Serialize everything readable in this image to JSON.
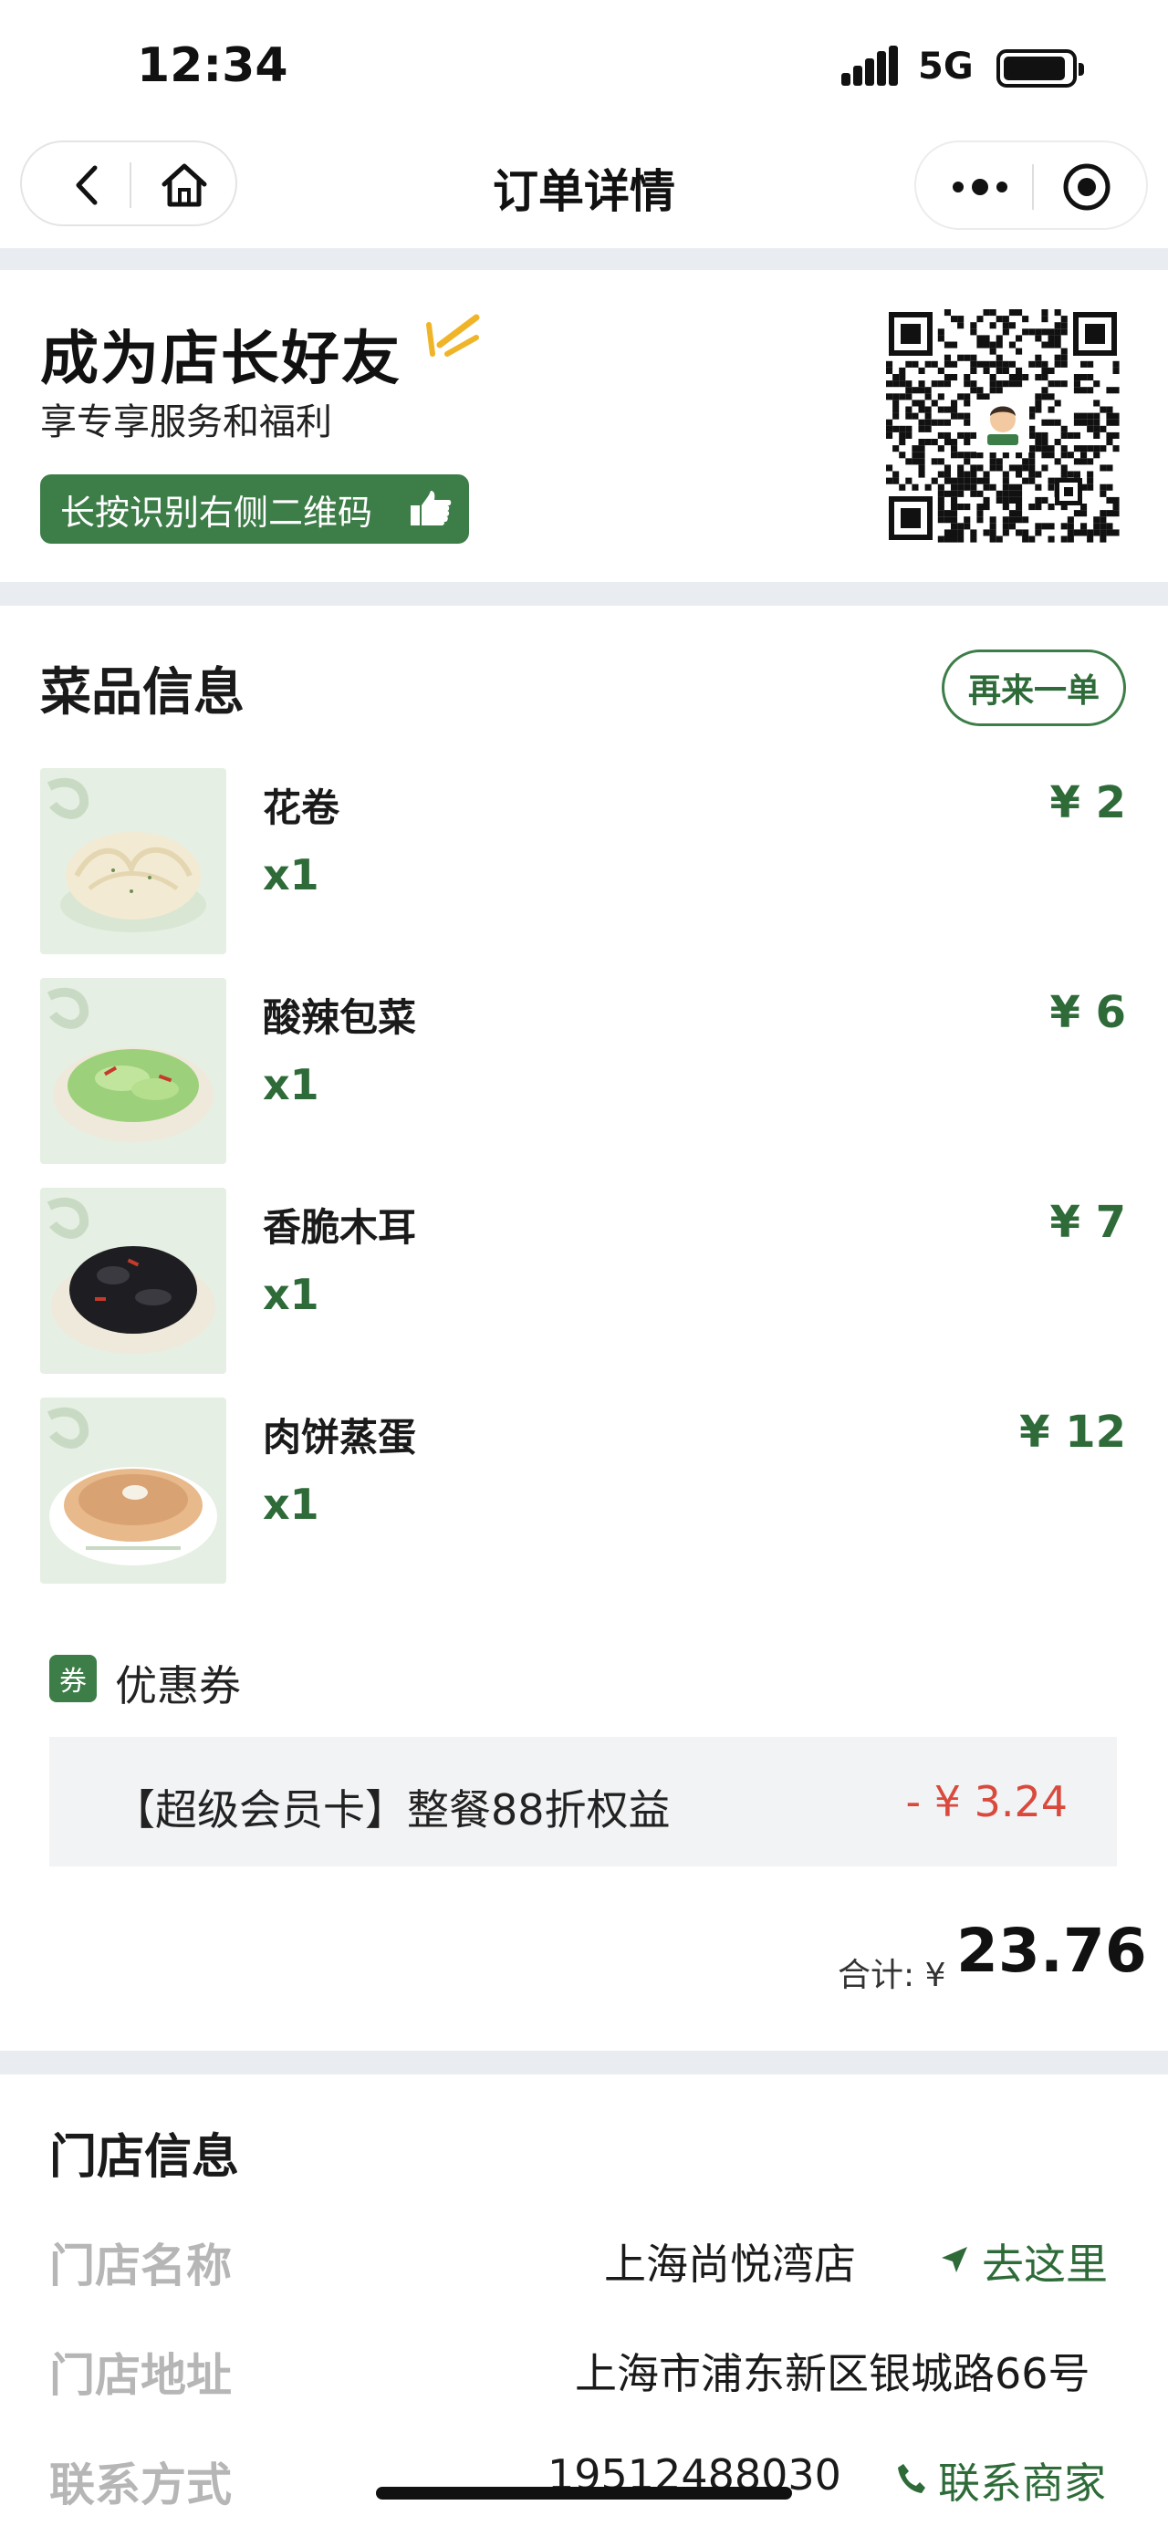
{
  "status_bar": {
    "time": "12:34",
    "network": "5G"
  },
  "nav": {
    "title": "订单详情"
  },
  "promo": {
    "title": "成为店长好友",
    "subtitle": "享专享服务和福利",
    "button_label": "长按识别右侧二维码"
  },
  "dishes": {
    "section_title": "菜品信息",
    "reorder_label": "再来一单",
    "items": [
      {
        "name": "花卷",
        "qty": "x1",
        "price": "¥ 2"
      },
      {
        "name": "酸辣包菜",
        "qty": "x1",
        "price": "¥ 6"
      },
      {
        "name": "香脆木耳",
        "qty": "x1",
        "price": "¥ 7"
      },
      {
        "name": "肉饼蒸蛋",
        "qty": "x1",
        "price": "¥ 12"
      }
    ]
  },
  "coupon": {
    "icon_text": "券",
    "label": "优惠券",
    "name": "【超级会员卡】整餐88折权益",
    "amount": "- ¥ 3.24"
  },
  "total": {
    "label": "合计: ¥",
    "value": "23.76"
  },
  "store": {
    "section_title": "门店信息",
    "rows": [
      {
        "label": "门店名称",
        "value": "上海尚悦湾店",
        "action": "去这里"
      },
      {
        "label": "门店地址",
        "value": "上海市浦东新区银城路66号"
      },
      {
        "label": "联系方式",
        "value": "19512488030",
        "action": "联系商家"
      }
    ]
  },
  "colors": {
    "brand_green": "#3d7d48",
    "discount_red": "#d94a3d",
    "divider_gray": "#e9edf1"
  }
}
